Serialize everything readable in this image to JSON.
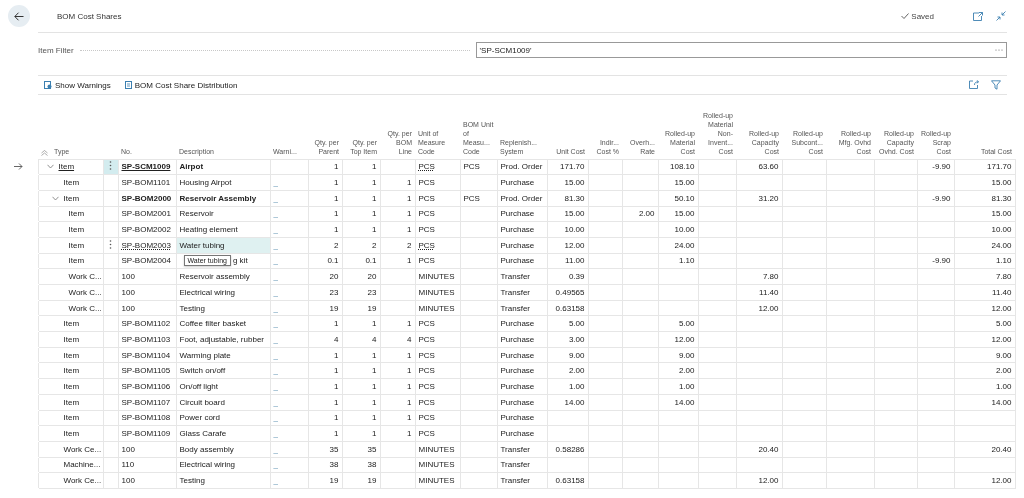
{
  "page": {
    "title": "BOM Cost Shares",
    "status": "Saved"
  },
  "filter": {
    "label": "Item Filter",
    "value": "'SP-SCM1009'"
  },
  "actions": [
    "Show Warnings",
    "BOM Cost Share Distribution"
  ],
  "table": {
    "lead_columns": [
      {
        "label": "Type",
        "sorted": true
      },
      {
        "label": "No.",
        "sorted": false
      },
      {
        "label": "Description",
        "sorted": false
      },
      {
        "label": "Warni...",
        "sorted": false
      }
    ],
    "columns": [
      {
        "label": "Qty. per Parent",
        "numeric": true
      },
      {
        "label": "Qty. per Top Item",
        "numeric": true
      },
      {
        "label": "Qty. per BOM Line",
        "numeric": true
      },
      {
        "label": "Unit of Measure Code",
        "numeric": false
      },
      {
        "label": "BOM Unit of Measu... Code",
        "numeric": false
      },
      {
        "label": "Replenish... System",
        "numeric": false
      },
      {
        "label": "Unit Cost",
        "numeric": true
      },
      {
        "label": "Indir... Cost %",
        "numeric": true
      },
      {
        "label": "Overh... Rate",
        "numeric": true
      },
      {
        "label": "Rolled-up Material Cost",
        "numeric": true
      },
      {
        "label": "Rolled-up Material Non-Invent... Cost",
        "numeric": true
      },
      {
        "label": "Rolled-up Capacity Cost",
        "numeric": true
      },
      {
        "label": "Rolled-up Subcont... Cost",
        "numeric": true
      },
      {
        "label": "Rolled-up Mfg. Ovhd Cost",
        "numeric": true
      },
      {
        "label": "Rolled-up Capacity Ovhd. Cost",
        "numeric": true
      },
      {
        "label": "Rolled-up Scrap Cost",
        "numeric": true
      },
      {
        "label": "Total Cost",
        "numeric": true
      }
    ],
    "rows": [
      {
        "type": "Item",
        "no": "SP-SCM1009",
        "description": "Airpot",
        "cells": [
          "1",
          "1",
          null,
          "PCS",
          "PCS",
          "Prod. Order",
          "171.70",
          null,
          null,
          "108.10",
          null,
          "63.60",
          null,
          null,
          null,
          "-9.90",
          "171.70"
        ],
        "selected": true,
        "hovered": false,
        "expanded": true,
        "children": [
          {
            "type": "Item",
            "no": "SP-BOM1101",
            "description": "Housing Airpot",
            "warning": "_",
            "cells": [
              "1",
              "1",
              "1",
              "PCS",
              null,
              "Purchase",
              "15.00",
              null,
              null,
              "15.00",
              null,
              null,
              null,
              null,
              null,
              null,
              "15.00"
            ],
            "selected": false,
            "hovered": false
          },
          {
            "type": "Item",
            "no": "SP-BOM2000",
            "description": "Reservoir Assembly",
            "warning": "_",
            "cells": [
              "1",
              "1",
              "1",
              "PCS",
              "PCS",
              "Prod. Order",
              "81.30",
              null,
              null,
              "50.10",
              null,
              "31.20",
              null,
              null,
              null,
              "-9.90",
              "81.30"
            ],
            "selected": false,
            "hovered": false,
            "expanded": true,
            "children": [
              {
                "type": "Item",
                "no": "SP-BOM2001",
                "description": "Reservoir",
                "warning": "_",
                "cells": [
                  "1",
                  "1",
                  "1",
                  "PCS",
                  null,
                  "Purchase",
                  "15.00",
                  null,
                  "2.00",
                  "15.00",
                  null,
                  null,
                  null,
                  null,
                  null,
                  null,
                  "15.00"
                ],
                "selected": false,
                "hovered": false
              },
              {
                "type": "Item",
                "no": "SP-BOM2002",
                "description": "Heating element",
                "warning": "_",
                "cells": [
                  "1",
                  "1",
                  "1",
                  "PCS",
                  null,
                  "Purchase",
                  "10.00",
                  null,
                  null,
                  "10.00",
                  null,
                  null,
                  null,
                  null,
                  null,
                  null,
                  "10.00"
                ],
                "selected": false,
                "hovered": false
              },
              {
                "type": "Item",
                "no": "SP-BOM2003",
                "description": "Water tubing",
                "warning": "_",
                "cells": [
                  "2",
                  "2",
                  "2",
                  "PCS",
                  null,
                  "Purchase",
                  "12.00",
                  null,
                  null,
                  "24.00",
                  null,
                  null,
                  null,
                  null,
                  null,
                  null,
                  "24.00"
                ],
                "selected": false,
                "hovered": true
              },
              {
                "type": "Item",
                "no": "SP-BOM2004",
                "tooltip": "Water tubing",
                "description": "g kit",
                "warning": "_",
                "cells": [
                  "0.1",
                  "0.1",
                  "1",
                  "PCS",
                  null,
                  "Purchase",
                  "11.00",
                  null,
                  null,
                  "1.10",
                  null,
                  null,
                  null,
                  null,
                  null,
                  "-9.90",
                  "1.10"
                ],
                "selected": false,
                "hovered": false
              },
              {
                "type": "Work C...",
                "no": "100",
                "description": "Reservoir assembly",
                "warning": "_",
                "cells": [
                  "20",
                  "20",
                  null,
                  "MINUTES",
                  null,
                  "Transfer",
                  "0.39",
                  null,
                  null,
                  null,
                  null,
                  "7.80",
                  null,
                  null,
                  null,
                  null,
                  "7.80"
                ],
                "selected": false,
                "hovered": false
              },
              {
                "type": "Work C...",
                "no": "100",
                "description": "Electrical wiring",
                "warning": "_",
                "cells": [
                  "23",
                  "23",
                  null,
                  "MINUTES",
                  null,
                  "Transfer",
                  "0.49565",
                  null,
                  null,
                  null,
                  null,
                  "11.40",
                  null,
                  null,
                  null,
                  null,
                  "11.40"
                ],
                "selected": false,
                "hovered": false
              },
              {
                "type": "Work C...",
                "no": "100",
                "description": "Testing",
                "warning": "_",
                "cells": [
                  "19",
                  "19",
                  null,
                  "MINUTES",
                  null,
                  "Transfer",
                  "0.63158",
                  null,
                  null,
                  null,
                  null,
                  "12.00",
                  null,
                  null,
                  null,
                  null,
                  "12.00"
                ],
                "selected": false,
                "hovered": false
              }
            ]
          },
          {
            "type": "Item",
            "no": "SP-BOM1102",
            "description": "Coffee filter basket",
            "warning": "_",
            "cells": [
              "1",
              "1",
              "1",
              "PCS",
              null,
              "Purchase",
              "5.00",
              null,
              null,
              "5.00",
              null,
              null,
              null,
              null,
              null,
              null,
              "5.00"
            ],
            "selected": false,
            "hovered": false
          },
          {
            "type": "Item",
            "no": "SP-BOM1103",
            "description": "Foot, adjustable, rubber",
            "warning": "_",
            "cells": [
              "4",
              "4",
              "4",
              "PCS",
              null,
              "Purchase",
              "3.00",
              null,
              null,
              "12.00",
              null,
              null,
              null,
              null,
              null,
              null,
              "12.00"
            ],
            "selected": false,
            "hovered": false
          },
          {
            "type": "Item",
            "no": "SP-BOM1104",
            "description": "Warming plate",
            "warning": "_",
            "cells": [
              "1",
              "1",
              "1",
              "PCS",
              null,
              "Purchase",
              "9.00",
              null,
              null,
              "9.00",
              null,
              null,
              null,
              null,
              null,
              null,
              "9.00"
            ],
            "selected": false,
            "hovered": false
          },
          {
            "type": "Item",
            "no": "SP-BOM1105",
            "description": "Switch on/off",
            "warning": "_",
            "cells": [
              "1",
              "1",
              "1",
              "PCS",
              null,
              "Purchase",
              "2.00",
              null,
              null,
              "2.00",
              null,
              null,
              null,
              null,
              null,
              null,
              "2.00"
            ],
            "selected": false,
            "hovered": false
          },
          {
            "type": "Item",
            "no": "SP-BOM1106",
            "description": "On/off light",
            "warning": "_",
            "cells": [
              "1",
              "1",
              "1",
              "PCS",
              null,
              "Purchase",
              "1.00",
              null,
              null,
              "1.00",
              null,
              null,
              null,
              null,
              null,
              null,
              "1.00"
            ],
            "selected": false,
            "hovered": false
          },
          {
            "type": "Item",
            "no": "SP-BOM1107",
            "description": "Circuit board",
            "warning": "_",
            "cells": [
              "1",
              "1",
              "1",
              "PCS",
              null,
              "Purchase",
              "14.00",
              null,
              null,
              "14.00",
              null,
              null,
              null,
              null,
              null,
              null,
              "14.00"
            ],
            "selected": false,
            "hovered": false
          },
          {
            "type": "Item",
            "no": "SP-BOM1108",
            "description": "Power cord",
            "warning": "_",
            "cells": [
              "1",
              "1",
              "1",
              "PCS",
              null,
              "Purchase",
              null,
              null,
              null,
              null,
              null,
              null,
              null,
              null,
              null,
              null,
              null
            ],
            "selected": false,
            "hovered": false
          },
          {
            "type": "Item",
            "no": "SP-BOM1109",
            "description": "Glass Carafe",
            "warning": "_",
            "cells": [
              "1",
              "1",
              "1",
              "PCS",
              null,
              "Purchase",
              null,
              null,
              null,
              null,
              null,
              null,
              null,
              null,
              null,
              null,
              null
            ],
            "selected": false,
            "hovered": false
          },
          {
            "type": "Work Ce...",
            "no": "100",
            "description": "Body assembly",
            "warning": "_",
            "cells": [
              "35",
              "35",
              null,
              "MINUTES",
              null,
              "Transfer",
              "0.58286",
              null,
              null,
              null,
              null,
              "20.40",
              null,
              null,
              null,
              null,
              "20.40"
            ],
            "selected": false,
            "hovered": false
          },
          {
            "type": "Machine...",
            "no": "110",
            "description": "Electrical wiring",
            "warning": "_",
            "cells": [
              "38",
              "38",
              null,
              "MINUTES",
              null,
              "Transfer",
              null,
              null,
              null,
              null,
              null,
              null,
              null,
              null,
              null,
              null,
              null
            ],
            "selected": false,
            "hovered": false
          },
          {
            "type": "Work Ce...",
            "no": "100",
            "description": "Testing",
            "warning": "_",
            "cells": [
              "19",
              "19",
              null,
              "MINUTES",
              null,
              "Transfer",
              "0.63158",
              null,
              null,
              null,
              null,
              "12.00",
              null,
              null,
              null,
              null,
              "12.00"
            ],
            "selected": false,
            "hovered": false
          }
        ]
      }
    ]
  }
}
